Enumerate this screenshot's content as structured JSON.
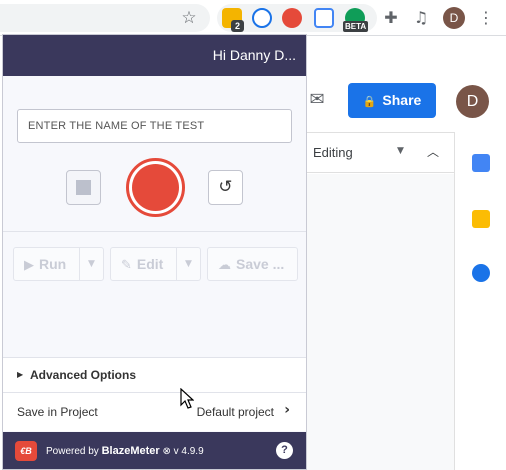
{
  "browser": {
    "extension_badge": "2",
    "beta_badge": "BETA",
    "profile_initial": "D",
    "icons": [
      "bookmark-star-icon",
      "extensions-puzzle-icon",
      "media-control-icon",
      "chrome-menu-icon"
    ]
  },
  "docs": {
    "share_label": "Share",
    "avatar_initial": "D",
    "mode_label": "Editing",
    "side_icons": [
      "calendar-icon",
      "keep-icon",
      "tasks-icon"
    ]
  },
  "popup": {
    "greeting": "Hi Danny D...",
    "test_name_placeholder": "ENTER THE NAME OF THE TEST",
    "actions": {
      "run_label": "Run",
      "edit_label": "Edit",
      "save_label": "Save ..."
    },
    "advanced_options_label": "Advanced Options",
    "save_in_project_label": "Save in Project",
    "default_project": "Default project",
    "footer": {
      "logo_text": "€B",
      "powered_prefix": "Powered by",
      "brand": "BlazeMeter",
      "version": "⊗ v 4.9.9",
      "help_label": "?"
    }
  },
  "colors": {
    "popup_header": "#3a385c",
    "record_red": "#e54a3a",
    "share_blue": "#1a73e8"
  }
}
